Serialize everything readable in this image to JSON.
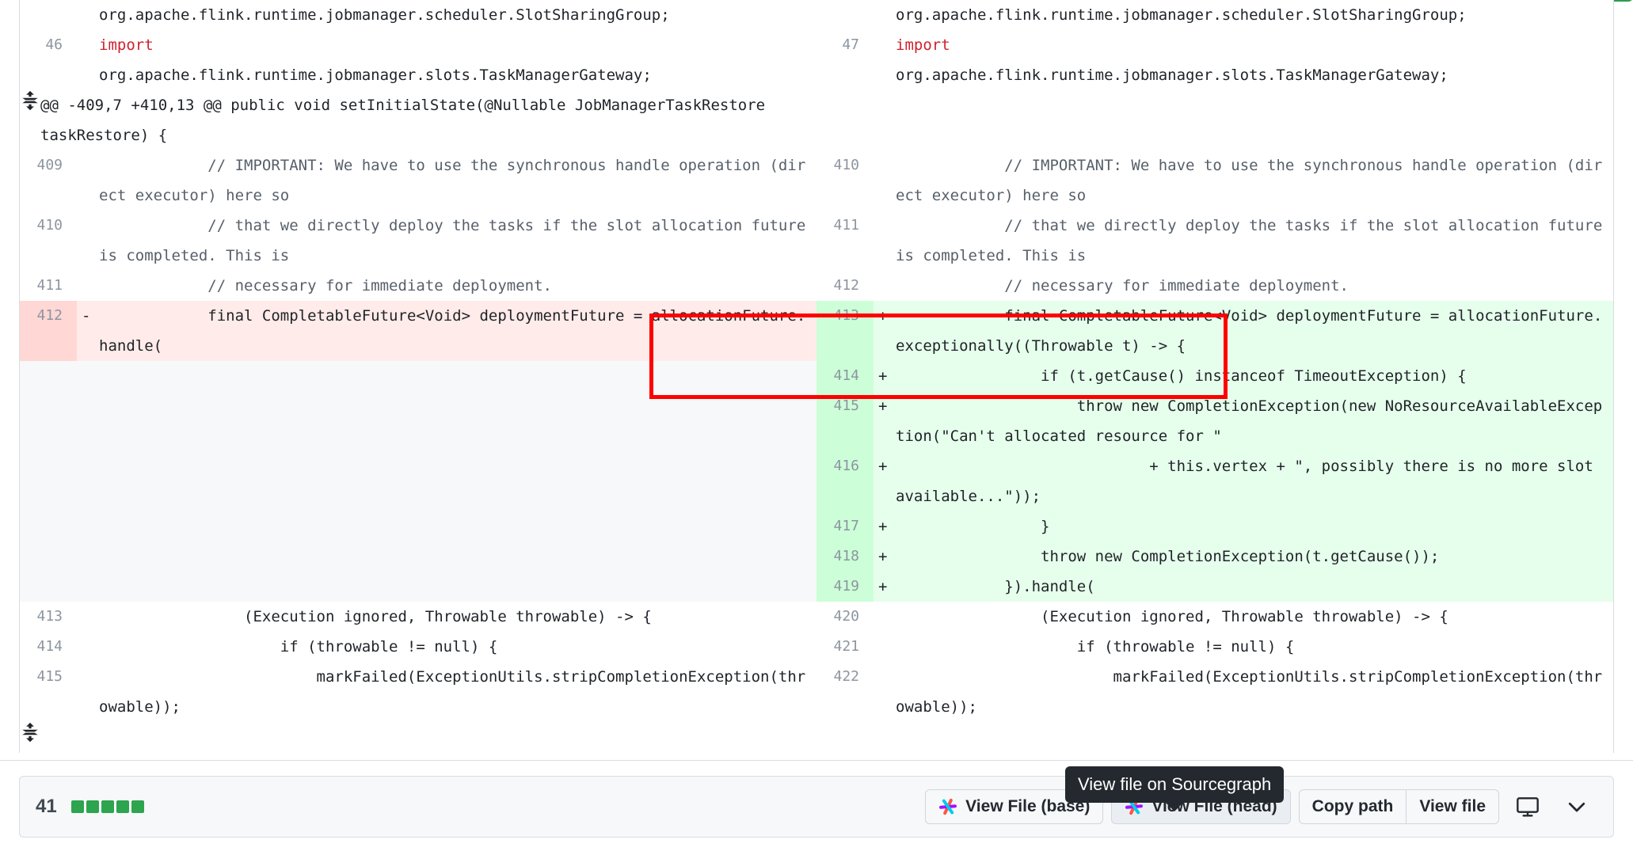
{
  "header": {
    "top_button_grey_label": "",
    "top_button_green_label": ""
  },
  "diff": {
    "hunk_header": "@@ -409,7 +410,13 @@ public void setInitialState(@Nullable JobManagerTaskRestore taskRestore) {",
    "expand_icon": "unfold-icon",
    "pre_hunk": {
      "left": [
        {
          "num": "",
          "marker": "",
          "code": "org.apache.flink.runtime.jobmanager.scheduler.SlotSharingGroup;",
          "type": "ctx"
        },
        {
          "num": "46",
          "marker": "",
          "code": "import",
          "type": "ctx"
        },
        {
          "num": "",
          "marker": "",
          "code": "org.apache.flink.runtime.jobmanager.slots.TaskManagerGateway;",
          "type": "ctx"
        }
      ],
      "right": [
        {
          "num": "",
          "marker": "",
          "code": "org.apache.flink.runtime.jobmanager.scheduler.SlotSharingGroup;",
          "type": "ctx"
        },
        {
          "num": "47",
          "marker": "",
          "code": "import",
          "type": "ctx"
        },
        {
          "num": "",
          "marker": "",
          "code": "org.apache.flink.runtime.jobmanager.slots.TaskManagerGateway;",
          "type": "ctx"
        }
      ]
    },
    "left_lines": [
      {
        "num": "409",
        "marker": "",
        "type": "ctx",
        "code": "            // IMPORTANT: We have to use the synchronous handle operation (direct executor) here so"
      },
      {
        "num": "410",
        "marker": "",
        "type": "ctx",
        "code": "            // that we directly deploy the tasks if the slot allocation future is completed. This is"
      },
      {
        "num": "411",
        "marker": "",
        "type": "ctx",
        "code": "            // necessary for immediate deployment."
      },
      {
        "num": "412",
        "marker": "-",
        "type": "del",
        "code": "            final CompletableFuture<Void> deploymentFuture = allocationFuture.handle("
      },
      {
        "num": "",
        "marker": "",
        "type": "spacer",
        "code": ""
      },
      {
        "num": "413",
        "marker": "",
        "type": "ctx",
        "code": "                (Execution ignored, Throwable throwable) -> {"
      },
      {
        "num": "414",
        "marker": "",
        "type": "ctx",
        "code": "                    if (throwable != null) {"
      },
      {
        "num": "415",
        "marker": "",
        "type": "ctx",
        "code": "                        markFailed(ExceptionUtils.stripCompletionException(throwable));"
      }
    ],
    "right_lines": [
      {
        "num": "410",
        "marker": "",
        "type": "ctx",
        "code": "            // IMPORTANT: We have to use the synchronous handle operation (direct executor) here so"
      },
      {
        "num": "411",
        "marker": "",
        "type": "ctx",
        "code": "            // that we directly deploy the tasks if the slot allocation future is completed. This is"
      },
      {
        "num": "412",
        "marker": "",
        "type": "ctx",
        "code": "            // necessary for immediate deployment."
      },
      {
        "num": "413",
        "marker": "+",
        "type": "add",
        "code": "            final CompletableFuture<Void> deploymentFuture = allocationFuture.exceptionally((Throwable t) -> {"
      },
      {
        "num": "414",
        "marker": "+",
        "type": "add",
        "code": "                if (t.getCause() instanceof TimeoutException) {"
      },
      {
        "num": "415",
        "marker": "+",
        "type": "add",
        "code": "                    throw new CompletionException(new NoResourceAvailableException(\"Can't allocated resource for \""
      },
      {
        "num": "416",
        "marker": "+",
        "type": "add",
        "code": "                            + this.vertex + \", possibly there is no more slot available...\"));"
      },
      {
        "num": "417",
        "marker": "+",
        "type": "add",
        "code": "                }"
      },
      {
        "num": "418",
        "marker": "+",
        "type": "add",
        "code": "                throw new CompletionException(t.getCause());"
      },
      {
        "num": "419",
        "marker": "+",
        "type": "add",
        "code": "            }).handle("
      },
      {
        "num": "420",
        "marker": "",
        "type": "ctx",
        "code": "                (Execution ignored, Throwable throwable) -> {"
      },
      {
        "num": "421",
        "marker": "",
        "type": "ctx",
        "code": "                    if (throwable != null) {"
      },
      {
        "num": "422",
        "marker": "",
        "type": "ctx",
        "code": "                        markFailed(ExceptionUtils.stripCompletionException(throwable));"
      }
    ],
    "bottom_expand_icon": "unfold-icon"
  },
  "tooltip": {
    "text": "View file on Sourcegraph"
  },
  "footer": {
    "diff_stat_count": "41",
    "diff_stat_blocks": 5,
    "diff_stat_color": "#2da44e",
    "buttons": [
      {
        "name": "view-file-base",
        "label": "View File (base)",
        "icon": "sourcegraph-icon",
        "pressed": false
      },
      {
        "name": "view-file-head",
        "label": "View File (head)",
        "icon": "sourcegraph-icon",
        "pressed": true
      }
    ],
    "group_buttons": [
      {
        "name": "copy-path",
        "label": "Copy path"
      },
      {
        "name": "view-file",
        "label": "View file"
      }
    ],
    "monitor_icon": "monitor-icon",
    "chevron_icon": "chevron-down-icon"
  }
}
